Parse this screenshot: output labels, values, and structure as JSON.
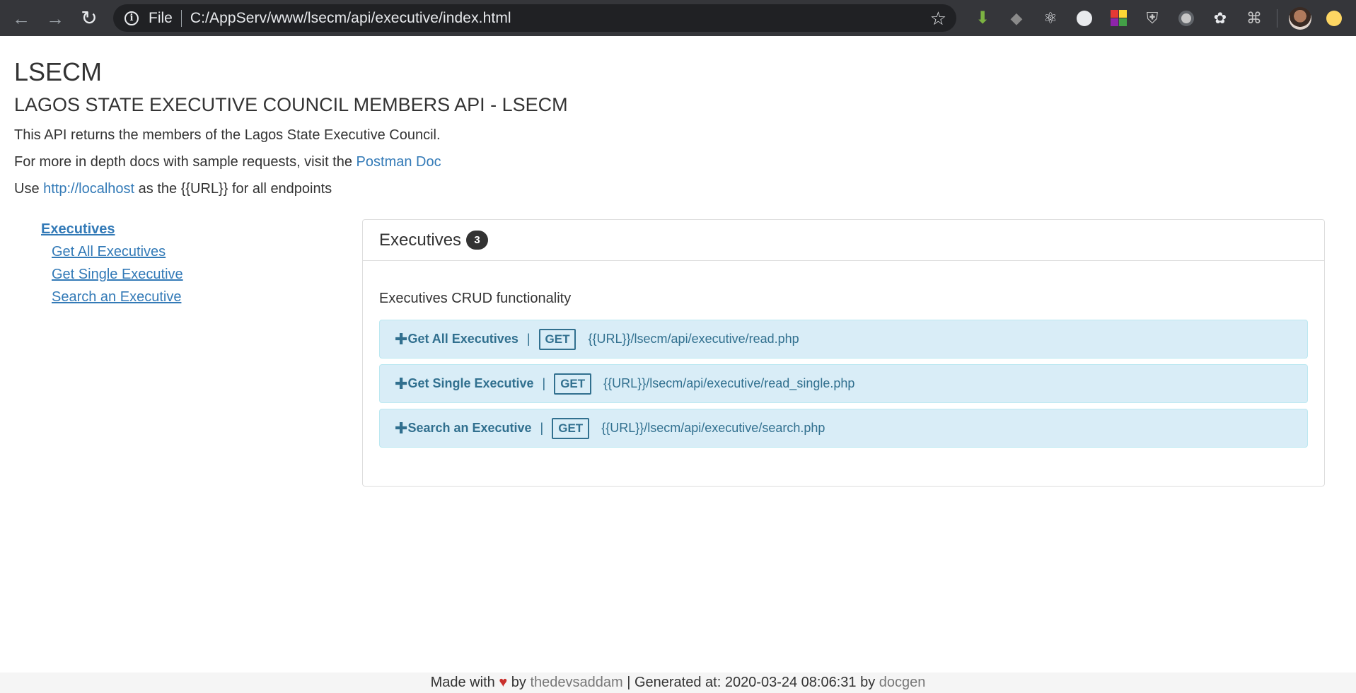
{
  "browser": {
    "scheme_label": "File",
    "url": "C:/AppServ/www/lsecm/api/executive/index.html"
  },
  "header": {
    "title": "LSECM",
    "subtitle": "LAGOS STATE EXECUTIVE COUNCIL MEMBERS API - LSECM"
  },
  "intro": {
    "line1": "This API returns the members of the Lagos State Executive Council.",
    "line2_prefix": "For more in depth docs with sample requests, visit the ",
    "line2_link": "Postman Doc",
    "line3_prefix": "Use ",
    "line3_link": "http://localhost",
    "line3_suffix": " as the {{URL}} for all endpoints"
  },
  "sidebar": {
    "group": "Executives",
    "items": [
      {
        "label": "Get All Executives"
      },
      {
        "label": "Get Single Executive"
      },
      {
        "label": "Search an Executive"
      }
    ]
  },
  "panel": {
    "title": "Executives",
    "count": "3",
    "description": "Executives CRUD functionality",
    "endpoints": [
      {
        "name": "Get All Executives",
        "method": "GET",
        "path": "{{URL}}/lsecm/api/executive/read.php"
      },
      {
        "name": "Get Single Executive",
        "method": "GET",
        "path": "{{URL}}/lsecm/api/executive/read_single.php"
      },
      {
        "name": "Search an Executive",
        "method": "GET",
        "path": "{{URL}}/lsecm/api/executive/search.php"
      }
    ]
  },
  "footer": {
    "made_with": "Made with",
    "heart": "♥",
    "by1": "by",
    "author": "thedevsaddam",
    "generated": "| Generated at: 2020-03-24 08:06:31 by",
    "tool": "docgen"
  },
  "colors": {
    "link": "#337ab7",
    "endpoint_bg": "#d9edf7",
    "endpoint_text": "#31708f",
    "chrome_bg": "#35363a"
  }
}
